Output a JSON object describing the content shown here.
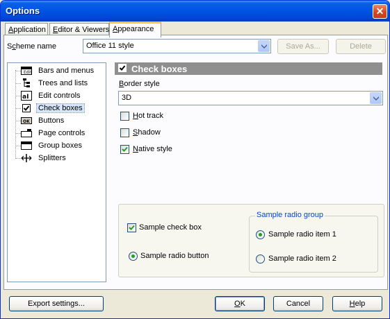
{
  "window": {
    "title": "Options",
    "close_glyph": "✕"
  },
  "tabs": [
    {
      "label": "Application",
      "mnemonic": "A",
      "rest": "pplication",
      "active": false
    },
    {
      "label": "Editor & Viewers",
      "mnemonic": "E",
      "rest": "ditor & Viewers",
      "active": false
    },
    {
      "label": "Appearance",
      "mnemonic": "A",
      "rest": "ppearance",
      "active": true
    }
  ],
  "scheme": {
    "label_pre": "S",
    "label_u": "c",
    "label_post": "heme name",
    "label": "Scheme name",
    "value": "Office 11 style",
    "save_as_label": "Save As...",
    "delete_label": "Delete"
  },
  "tree": {
    "items": [
      {
        "label": "Bars and menus",
        "icon": "bars-menus-icon",
        "selected": false
      },
      {
        "label": "Trees and lists",
        "icon": "tree-list-icon",
        "selected": false
      },
      {
        "label": "Edit controls",
        "icon": "edit-control-icon",
        "selected": false
      },
      {
        "label": "Check boxes",
        "icon": "checkbox-icon",
        "selected": true
      },
      {
        "label": "Buttons",
        "icon": "button-ok-icon",
        "selected": false
      },
      {
        "label": "Page controls",
        "icon": "page-control-icon",
        "selected": false
      },
      {
        "label": "Group boxes",
        "icon": "group-box-icon",
        "selected": false
      },
      {
        "label": "Splitters",
        "icon": "splitter-icon",
        "selected": false
      }
    ]
  },
  "section": {
    "header": "Check boxes",
    "border_style_label_pre": "B",
    "border_style_label_post": "order style",
    "border_style_value": "3D",
    "options": [
      {
        "u": "H",
        "rest": "ot track",
        "label": "Hot track",
        "checked": false
      },
      {
        "u": "S",
        "rest": "hadow",
        "label": "Shadow",
        "checked": false
      },
      {
        "u": "N",
        "rest": "ative style",
        "label": "Native style",
        "checked": true
      }
    ]
  },
  "sample": {
    "check_box_label": "Sample check box",
    "check_box_checked": true,
    "radio_button_label": "Sample radio button",
    "radio_button_checked": true,
    "group_title": "Sample radio group",
    "group_items": [
      {
        "label": "Sample radio item 1",
        "checked": true
      },
      {
        "label": "Sample radio item 2",
        "checked": false
      }
    ]
  },
  "footer": {
    "export_label": "Export settings...",
    "ok_label": "OK",
    "ok_u": "O",
    "ok_rest": "K",
    "cancel_label": "Cancel",
    "help_label": "Help",
    "help_u": "H",
    "help_rest": "elp"
  },
  "colors": {
    "title_bar": "#0055e5",
    "accent_tab": "#ffc83c",
    "check_green": "#21a121",
    "section_header": "#8f8f8f"
  }
}
